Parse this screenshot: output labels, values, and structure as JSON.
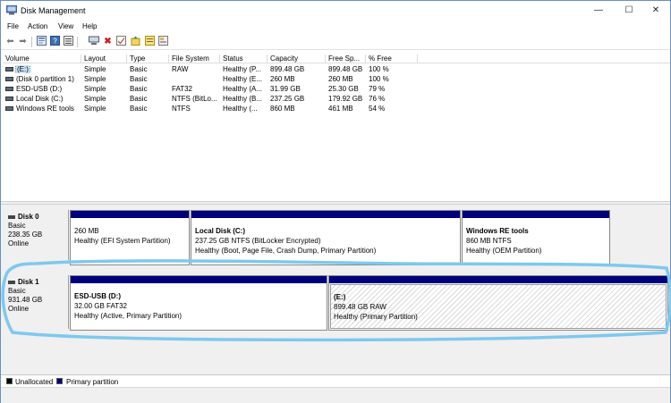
{
  "window": {
    "title": "Disk Management",
    "controls": {
      "minimize": "—",
      "maximize": "☐",
      "close": "✕"
    }
  },
  "menu": [
    "File",
    "Action",
    "View",
    "Help"
  ],
  "toolbar": [
    "back-icon",
    "forward-icon",
    "properties-icon",
    "help-icon",
    "connect-icon",
    "delete-icon",
    "check-icon",
    "format-icon",
    "refresh-icon"
  ],
  "volumes": {
    "headers": [
      "Volume",
      "Layout",
      "Type",
      "File System",
      "Status",
      "Capacity",
      "Free Sp...",
      "% Free"
    ],
    "rows": [
      {
        "name": "(E:)",
        "layout": "Simple",
        "type": "Basic",
        "fs": "RAW",
        "status": "Healthy (P...",
        "capacity": "899.48 GB",
        "free": "899.48 GB",
        "pct": "100 %"
      },
      {
        "name": "(Disk 0 partition 1)",
        "layout": "Simple",
        "type": "Basic",
        "fs": "",
        "status": "Healthy (E...",
        "capacity": "260 MB",
        "free": "260 MB",
        "pct": "100 %"
      },
      {
        "name": "ESD-USB (D:)",
        "layout": "Simple",
        "type": "Basic",
        "fs": "FAT32",
        "status": "Healthy (A...",
        "capacity": "31.99 GB",
        "free": "25.30 GB",
        "pct": "79 %"
      },
      {
        "name": "Local Disk (C:)",
        "layout": "Simple",
        "type": "Basic",
        "fs": "NTFS (BitLo...",
        "status": "Healthy (B...",
        "capacity": "237.25 GB",
        "free": "179.92 GB",
        "pct": "76 %"
      },
      {
        "name": "Windows RE tools",
        "layout": "Simple",
        "type": "Basic",
        "fs": "NTFS",
        "status": "Healthy (...",
        "capacity": "860 MB",
        "free": "461 MB",
        "pct": "54 %"
      }
    ]
  },
  "disks": [
    {
      "name": "Disk 0",
      "type": "Basic",
      "size": "238.35 GB",
      "state": "Online",
      "partitions": [
        {
          "name": "",
          "size": "260 MB",
          "status": "Healthy (EFI System Partition)"
        },
        {
          "name": "Local Disk  (C:)",
          "size": "237.25 GB NTFS (BitLocker Encrypted)",
          "status": "Healthy (Boot, Page File, Crash Dump, Primary Partition)"
        },
        {
          "name": "Windows RE tools",
          "size": "860 MB NTFS",
          "status": "Healthy (OEM Partition)"
        }
      ]
    },
    {
      "name": "Disk 1",
      "type": "Basic",
      "size": "931.48 GB",
      "state": "Online",
      "partitions": [
        {
          "name": "ESD-USB  (D:)",
          "size": "32.00 GB FAT32",
          "status": "Healthy (Active, Primary Partition)"
        },
        {
          "name": "(E:)",
          "size": "899.48 GB RAW",
          "status": "Healthy (Primary Partition)"
        }
      ]
    }
  ],
  "legend": [
    {
      "label": "Unallocated",
      "color": "#000000"
    },
    {
      "label": "Primary partition",
      "color": "#00007d"
    }
  ],
  "colors": {
    "partition_bar": "#00007d",
    "annotation": "#7ec8ef",
    "selection": "#cce4f7"
  }
}
